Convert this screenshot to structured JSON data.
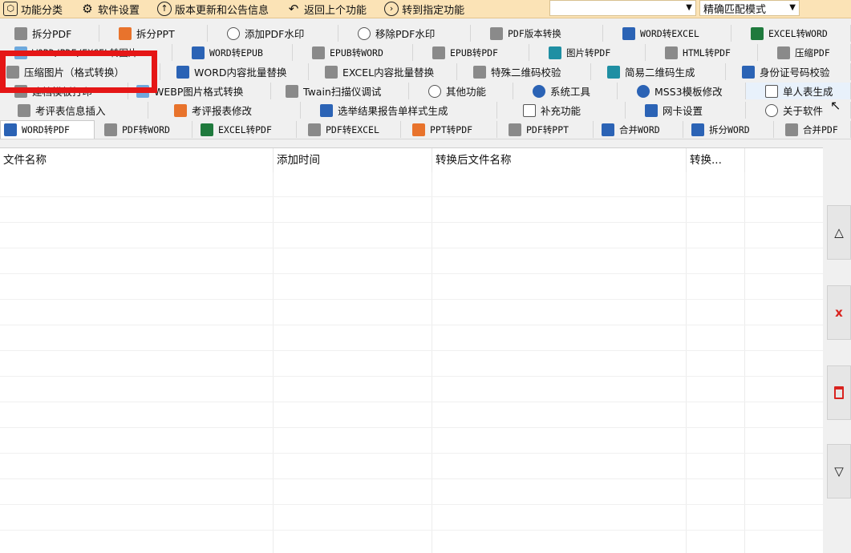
{
  "toolbar": {
    "items": [
      {
        "icon": "hexagon-icon",
        "label": "功能分类"
      },
      {
        "icon": "gear-icon",
        "label": "软件设置"
      },
      {
        "icon": "arrow-up-circle-icon",
        "label": "版本更新和公告信息"
      },
      {
        "icon": "back-arrow-icon",
        "label": "返回上个功能"
      },
      {
        "icon": "arrow-right-circle-icon",
        "label": "转到指定功能"
      }
    ],
    "search_value": "",
    "match_mode": "精确匹配模式"
  },
  "tab_rows": [
    [
      {
        "label": "拆分PDF",
        "icon": "pdf-icon"
      },
      {
        "label": "拆分PPT",
        "icon": "ppt-icon"
      },
      {
        "label": "添加PDF水印",
        "icon": "watermark-icon"
      },
      {
        "label": "移除PDF水印",
        "icon": "watermark-icon"
      },
      {
        "label": "PDF版本转换",
        "icon": "pdf-icon"
      },
      {
        "label": "WORD转EXCEL",
        "icon": "word-icon"
      },
      {
        "label": "EXCEL转WORD",
        "icon": "excel-icon"
      }
    ],
    [
      {
        "label": "WORD/PDF/EXCEL转图片",
        "icon": "image-icon"
      },
      {
        "label": "WORD转EPUB",
        "icon": "word-icon"
      },
      {
        "label": "EPUB转WORD",
        "icon": "epub-icon"
      },
      {
        "label": "EPUB转PDF",
        "icon": "epub-icon"
      },
      {
        "label": "图片转PDF",
        "icon": "image-icon"
      },
      {
        "label": "HTML转PDF",
        "icon": "html-icon"
      },
      {
        "label": "压缩PDF",
        "icon": "compress-icon"
      }
    ],
    [
      {
        "label": "压缩图片（格式转换）",
        "icon": "compress-icon"
      },
      {
        "label": "WORD内容批量替换",
        "icon": "word-icon"
      },
      {
        "label": "EXCEL内容批量替换",
        "icon": "excel-icon"
      },
      {
        "label": "特殊二维码校验",
        "icon": "qrcode-icon"
      },
      {
        "label": "简易二维码生成",
        "icon": "qrcode-icon"
      },
      {
        "label": "身份证号码校验",
        "icon": "id-card-icon"
      }
    ],
    [
      {
        "label": "建档模板打印",
        "icon": "print-icon"
      },
      {
        "label": "WEBP图片格式转换",
        "icon": "image-icon"
      },
      {
        "label": "Twain扫描仪调试",
        "icon": "scanner-icon"
      },
      {
        "label": "其他功能",
        "icon": "more-icon"
      },
      {
        "label": "系统工具",
        "icon": "gear-icon"
      },
      {
        "label": "MSS3模板修改",
        "icon": "gear-icon"
      },
      {
        "label": "单人表生成",
        "icon": "document-icon"
      }
    ],
    [
      {
        "label": "考评表信息插入",
        "icon": "table-icon"
      },
      {
        "label": "考评报表修改",
        "icon": "table-icon"
      },
      {
        "label": "选举结果报告单样式生成",
        "icon": "table-icon"
      },
      {
        "label": "补充功能",
        "icon": "document-icon"
      },
      {
        "label": "网卡设置",
        "icon": "network-icon"
      },
      {
        "label": "关于软件",
        "icon": "info-icon"
      }
    ],
    [
      {
        "label": "WORD转PDF",
        "icon": "word-icon"
      },
      {
        "label": "PDF转WORD",
        "icon": "pdf-icon"
      },
      {
        "label": "EXCEL转PDF",
        "icon": "excel-icon"
      },
      {
        "label": "PDF转EXCEL",
        "icon": "pdf-icon"
      },
      {
        "label": "PPT转PDF",
        "icon": "ppt-icon"
      },
      {
        "label": "PDF转PPT",
        "icon": "pdf-icon"
      },
      {
        "label": "合并WORD",
        "icon": "word-icon"
      },
      {
        "label": "拆分WORD",
        "icon": "word-icon"
      },
      {
        "label": "合并PDF",
        "icon": "pdf-icon"
      }
    ]
  ],
  "table": {
    "columns": [
      "文件名称",
      "添加时间",
      "转换后文件名称",
      "转换..."
    ],
    "rows": []
  },
  "side_buttons": [
    {
      "icon": "triangle-up-icon",
      "glyph": "△"
    },
    {
      "icon": "close-icon",
      "glyph": "x"
    },
    {
      "icon": "trash-icon",
      "glyph": "🗑"
    },
    {
      "icon": "triangle-down-icon",
      "glyph": "▽"
    }
  ],
  "colors": {
    "toolbar_bg": "#fbe3b6",
    "highlight": "#e51616",
    "delete_red": "#d9231f"
  }
}
